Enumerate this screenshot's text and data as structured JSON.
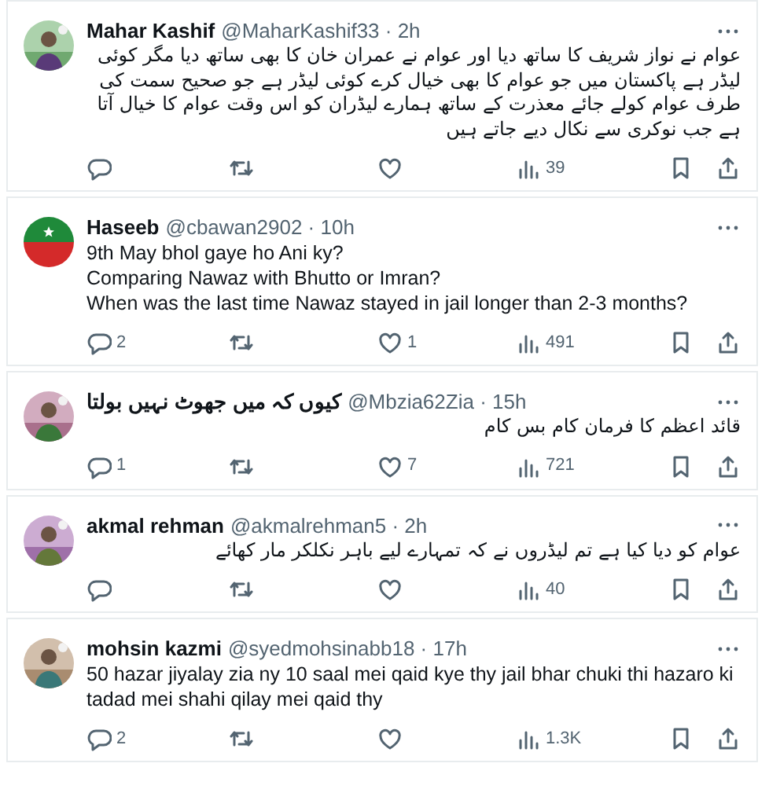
{
  "tweets": [
    {
      "name": "Mahar Kashif",
      "meta": "@MaharKashif33 · 2h",
      "text": "عوام نے نواز شریف کا ساتھ دیا اور عوام نے عمران خان کا بھی ساتھ دیا مگر کوئی لیڈر ہے پاکستان میں جو عوام کا بھی خیال کرے کوئی لیڈر ہے جو صحیح سمت کی طرف عوام کولے جائے معذرت کے ساتھ ہمارے لیڈران کو اس وقت عوام کا خیال آتا ہے جب نوکری سے نکال دیے جاتے ہیں",
      "views": "39"
    },
    {
      "avatar": {
        "kind": "flag"
      },
      "name": "Haseeb",
      "meta": "@cbawan2902 · 10h",
      "text": "9th May bhol gaye ho Ani ky?\nComparing Nawaz with Bhutto or Imran?\nWhen was the last time Nawaz stayed in jail longer than 2-3 months?",
      "replies": "2",
      "likes": "1",
      "views": "491"
    },
    {
      "name": "کیوں کہ میں جھوٹ نہیں بولتا",
      "meta": "@Mbzia62Zia · 15h",
      "text": "قائد اعظم کا فرمان کام بس کام",
      "replies": "1",
      "likes": "7",
      "views": "721"
    },
    {
      "name": "akmal rehman",
      "meta": "@akmalrehman5 · 2h",
      "text": "عوام کو دیا کیا ہے تم لیڈروں نے کہ تمہارے لیے باہر نکلکر مار کھائے",
      "views": "40"
    },
    {
      "name": "mohsin kazmi",
      "meta": "@syedmohsinabb18 · 17h",
      "text": "50 hazar jiyalay zia ny 10 saal mei qaid kye thy jail bhar chuki thi hazaro ki tadad mei shahi qilay mei qaid thy",
      "replies": "2",
      "views": "1.3K"
    }
  ]
}
